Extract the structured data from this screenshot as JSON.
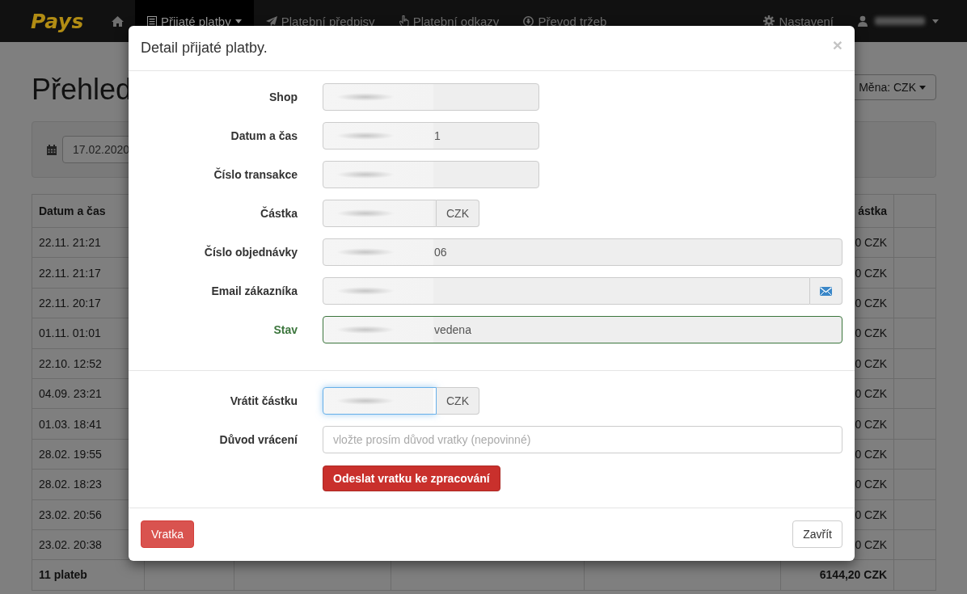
{
  "navbar": {
    "brand": "Pays",
    "items": [
      {
        "label": "Přijaté platby",
        "selected": true,
        "dropdown": true
      },
      {
        "label": "Platební předpisy",
        "selected": false,
        "dropdown": false
      },
      {
        "label": "Platební odkazy",
        "selected": false,
        "dropdown": false
      },
      {
        "label": "Převod tržeb",
        "selected": false,
        "dropdown": false
      }
    ],
    "right": [
      {
        "kind": "settings",
        "label": "Nastavení",
        "dropdown": false
      },
      {
        "kind": "user",
        "dropdown": true,
        "redacted": true
      }
    ]
  },
  "page": {
    "title": "Přehled",
    "date": "17.02.2020",
    "currency_button": "Měna: CZK"
  },
  "table": {
    "columns": [
      "Datum a čas",
      "ástka"
    ],
    "rows": [
      {
        "date": "22.11. 21:21",
        "amount": "0 CZK"
      },
      {
        "date": "22.11. 21:17",
        "amount": "0 CZK"
      },
      {
        "date": "22.11. 20:17",
        "amount": "0 CZK"
      },
      {
        "date": "01.11. 01:01",
        "amount": "0 CZK"
      },
      {
        "date": "22.10. 12:52",
        "amount": "0 CZK"
      },
      {
        "date": "04.09. 23:21",
        "amount": "0 CZK"
      },
      {
        "date": "01.03. 18:41",
        "amount": "0 CZK"
      },
      {
        "date": "28.02. 19:55",
        "amount": "0 CZK"
      },
      {
        "date": "28.02. 18:23",
        "amount": "0 CZK"
      },
      {
        "date": "23.02. 20:56",
        "amount": "0 CZK"
      },
      {
        "date": "23.02. 20:38",
        "amount": "0 CZK"
      }
    ],
    "footer": {
      "count": "11 plateb",
      "total": "6144,20 CZK"
    }
  },
  "modal": {
    "title": "Detail přijaté platby.",
    "close": "×",
    "fields": [
      {
        "label": "Shop",
        "kind": "short",
        "redacted": true,
        "valid": false,
        "focused": false
      },
      {
        "label": "Datum a čas",
        "kind": "short",
        "value": "1",
        "redacted": true,
        "valid": false,
        "focused": false
      },
      {
        "label": "Číslo transakce",
        "kind": "short",
        "redacted": true,
        "valid": false,
        "focused": false
      },
      {
        "label": "Částka",
        "kind": "amount",
        "addon": "CZK",
        "redacted": true,
        "valid": false,
        "focused": false
      },
      {
        "label": "Číslo objednávky",
        "kind": "wide",
        "value": "06",
        "redacted": true,
        "valid": false,
        "focused": false
      },
      {
        "label": "Email zákazníka",
        "kind": "email",
        "redacted": true,
        "valid": false,
        "focused": false
      },
      {
        "label": "Stav",
        "kind": "wide",
        "value": "vedena",
        "redacted": true,
        "valid": true,
        "focused": false
      }
    ],
    "refund_fields": [
      {
        "label": "Vrátit částku",
        "kind": "amount",
        "addon": "CZK",
        "redacted": true,
        "valid": false,
        "focused": true,
        "editable": true
      },
      {
        "label": "Důvod vrácení",
        "kind": "wide",
        "placeholder": "vložte prosím důvod vratky (nepovinné)",
        "redacted": false,
        "valid": false,
        "focused": false,
        "editable": true
      }
    ],
    "submit_button": "Odeslat vratku ke zpracování",
    "footer_buttons": [
      {
        "kind": "danger",
        "label": "Vratka"
      },
      {
        "kind": "default",
        "label": "Zavřít"
      }
    ]
  }
}
